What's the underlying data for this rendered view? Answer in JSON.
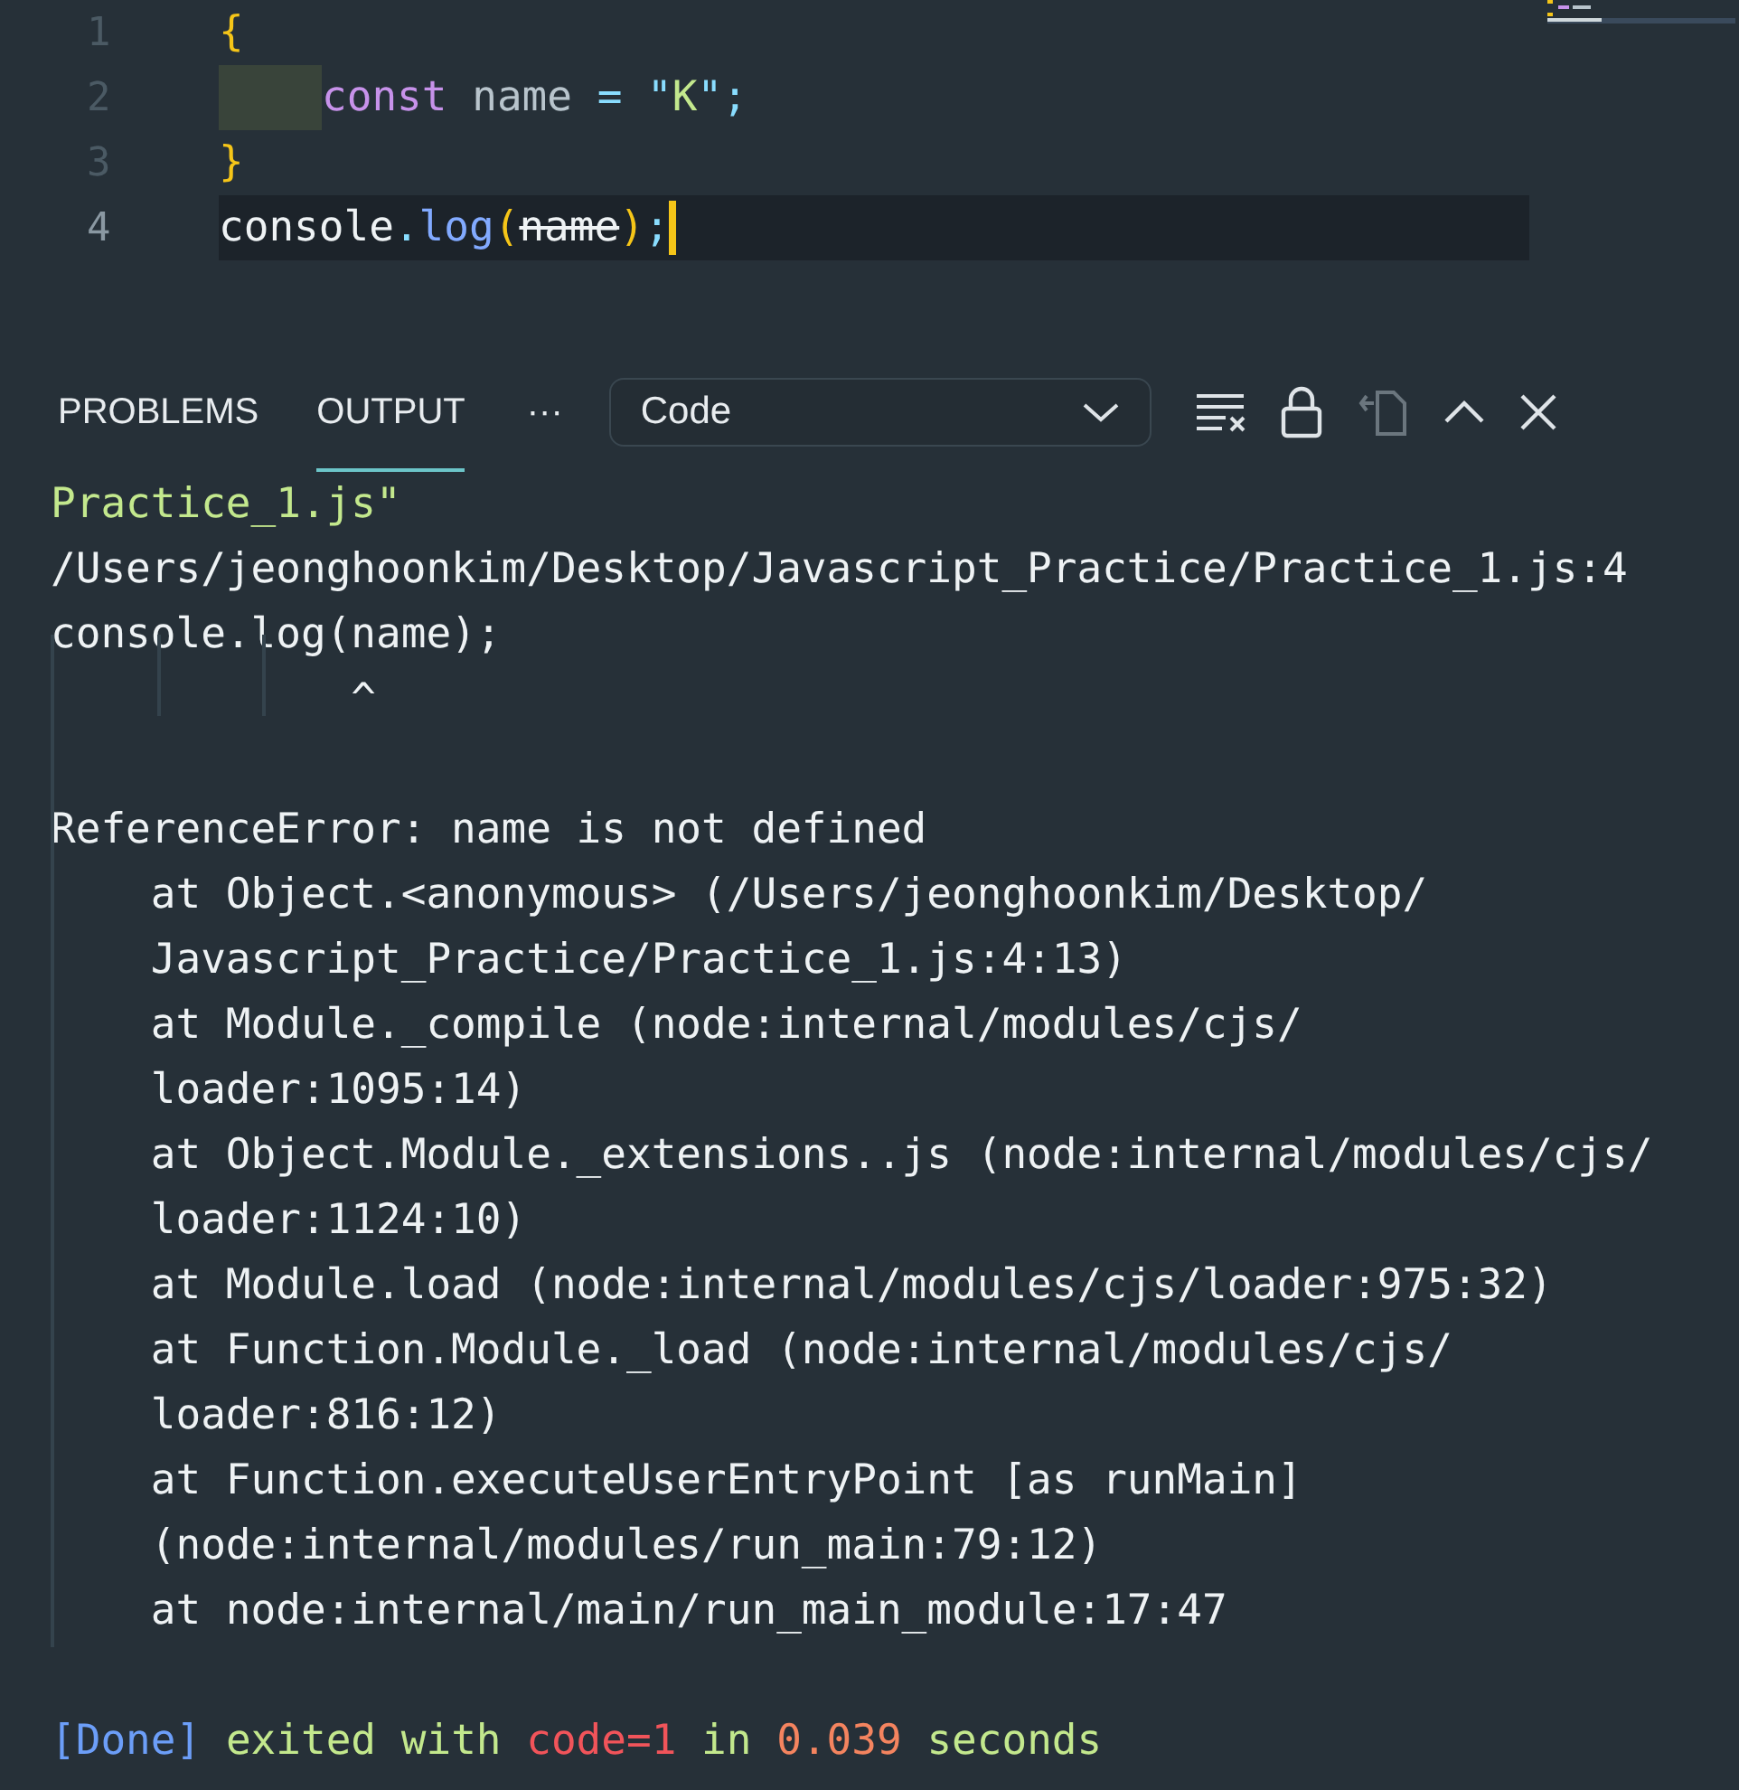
{
  "editor": {
    "lines": [
      {
        "number": "1",
        "active": false,
        "lint_indent": false,
        "tokens": [
          {
            "text": "{",
            "kind": "brace"
          }
        ]
      },
      {
        "number": "2",
        "active": false,
        "lint_indent": true,
        "tokens": [
          {
            "text": "const",
            "kind": "keyword"
          },
          {
            "text": " name ",
            "kind": "variable"
          },
          {
            "text": "=",
            "kind": "operator"
          },
          {
            "text": " \"",
            "kind": "punct"
          },
          {
            "text": "K",
            "kind": "string"
          },
          {
            "text": "\";",
            "kind": "punct"
          }
        ]
      },
      {
        "number": "3",
        "active": false,
        "lint_indent": false,
        "tokens": [
          {
            "text": "}",
            "kind": "brace"
          }
        ]
      },
      {
        "number": "4",
        "active": true,
        "lint_indent": false,
        "tokens": [
          {
            "text": "console",
            "kind": "plain"
          },
          {
            "text": ".",
            "kind": "punct"
          },
          {
            "text": "log",
            "kind": "function"
          },
          {
            "text": "(",
            "kind": "brace"
          },
          {
            "text": "name",
            "kind": "deprecated"
          },
          {
            "text": ")",
            "kind": "brace"
          },
          {
            "text": ";",
            "kind": "punct"
          }
        ]
      }
    ]
  },
  "panel": {
    "tabs": [
      {
        "label": "PROBLEMS",
        "selected": false
      },
      {
        "label": "OUTPUT",
        "selected": true
      }
    ],
    "more": "···",
    "channel": "Code"
  },
  "output": [
    {
      "kind": "line",
      "tokens": [
        {
          "text": "Practice_1.js\"",
          "kind": "string"
        }
      ]
    },
    {
      "kind": "line",
      "tokens": [
        {
          "text": "/Users/jeonghoonkim/Desktop/Javascript_Practice/Practice_1.js:4",
          "kind": "plain"
        }
      ]
    },
    {
      "kind": "line",
      "tokens": [
        {
          "text": "console.log(name);",
          "kind": "plain"
        }
      ]
    },
    {
      "kind": "line",
      "tokens": [
        {
          "text": "            ^",
          "kind": "plain"
        }
      ]
    },
    {
      "kind": "blank"
    },
    {
      "kind": "line",
      "tokens": [
        {
          "text": "ReferenceError: name is not defined",
          "kind": "plain"
        }
      ]
    },
    {
      "kind": "line",
      "tokens": [
        {
          "text": "    at Object.<anonymous> (/Users/jeonghoonkim/Desktop/",
          "kind": "plain"
        }
      ]
    },
    {
      "kind": "line",
      "tokens": [
        {
          "text": "    Javascript_Practice/Practice_1.js:4:13)",
          "kind": "plain"
        }
      ]
    },
    {
      "kind": "line",
      "tokens": [
        {
          "text": "    at Module._compile (node:internal/modules/cjs/",
          "kind": "plain"
        }
      ]
    },
    {
      "kind": "line",
      "tokens": [
        {
          "text": "    loader:1095:14)",
          "kind": "plain"
        }
      ]
    },
    {
      "kind": "line",
      "tokens": [
        {
          "text": "    at Object.Module._extensions..js (node:internal/modules/cjs/",
          "kind": "plain"
        }
      ]
    },
    {
      "kind": "line",
      "tokens": [
        {
          "text": "    loader:1124:10)",
          "kind": "plain"
        }
      ]
    },
    {
      "kind": "line",
      "tokens": [
        {
          "text": "    at Module.load (node:internal/modules/cjs/loader:975:32)",
          "kind": "plain"
        }
      ]
    },
    {
      "kind": "line",
      "tokens": [
        {
          "text": "    at Function.Module._load (node:internal/modules/cjs/",
          "kind": "plain"
        }
      ]
    },
    {
      "kind": "line",
      "tokens": [
        {
          "text": "    loader:816:12)",
          "kind": "plain"
        }
      ]
    },
    {
      "kind": "line",
      "tokens": [
        {
          "text": "    at Function.executeUserEntryPoint [as runMain]",
          "kind": "plain"
        }
      ]
    },
    {
      "kind": "line",
      "tokens": [
        {
          "text": "    (node:internal/modules/run_main:79:12)",
          "kind": "plain"
        }
      ]
    },
    {
      "kind": "line",
      "tokens": [
        {
          "text": "    at node:internal/main/run_main_module:17:47",
          "kind": "plain"
        }
      ]
    },
    {
      "kind": "blank"
    },
    {
      "kind": "line",
      "tokens": [
        {
          "text": "[Done]",
          "kind": "done"
        },
        {
          "text": " exited with ",
          "kind": "string"
        },
        {
          "text": "code=1",
          "kind": "error"
        },
        {
          "text": " in ",
          "kind": "string"
        },
        {
          "text": "0.039",
          "kind": "number"
        },
        {
          "text": " seconds",
          "kind": "string"
        }
      ]
    }
  ]
}
